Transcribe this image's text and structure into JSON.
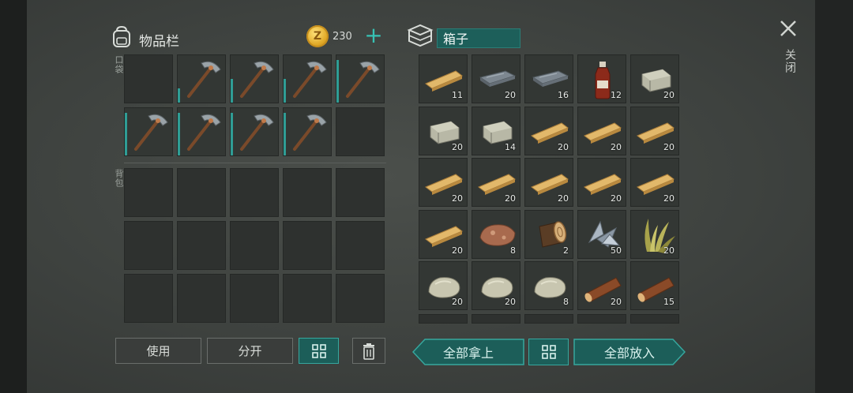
{
  "inventory": {
    "title": "物品栏",
    "coin_symbol": "Z",
    "coins": "230",
    "add_label": "+",
    "pocket_label": "口袋",
    "backpack_label": "背包",
    "pocket_slots": [
      {
        "item": "empty"
      },
      {
        "item": "pickaxe",
        "durability": 0.3
      },
      {
        "item": "pickaxe",
        "durability": 0.5
      },
      {
        "item": "pickaxe",
        "durability": 0.5
      },
      {
        "item": "pickaxe",
        "durability": 0.9
      },
      {
        "item": "pickaxe",
        "durability": 0.9
      },
      {
        "item": "pickaxe",
        "durability": 0.9
      },
      {
        "item": "pickaxe",
        "durability": 0.9
      },
      {
        "item": "pickaxe",
        "durability": 0.9
      },
      {
        "item": "empty"
      }
    ],
    "backpack_rows": 3,
    "buttons": {
      "use": "使用",
      "split": "分开"
    }
  },
  "box": {
    "title": "箱子",
    "slots": [
      {
        "item": "plank",
        "count": "11"
      },
      {
        "item": "iron-bar",
        "count": "20"
      },
      {
        "item": "iron-bar",
        "count": "16"
      },
      {
        "item": "bottle",
        "count": "12"
      },
      {
        "item": "stone-block",
        "count": "20"
      },
      {
        "item": "stone-block",
        "count": "20"
      },
      {
        "item": "stone-block",
        "count": "14"
      },
      {
        "item": "plank",
        "count": "20"
      },
      {
        "item": "plank",
        "count": "20"
      },
      {
        "item": "plank",
        "count": "20"
      },
      {
        "item": "plank",
        "count": "20"
      },
      {
        "item": "plank",
        "count": "20"
      },
      {
        "item": "plank",
        "count": "20"
      },
      {
        "item": "plank",
        "count": "20"
      },
      {
        "item": "plank",
        "count": "20"
      },
      {
        "item": "plank",
        "count": "20"
      },
      {
        "item": "ore",
        "count": "8"
      },
      {
        "item": "log",
        "count": "2"
      },
      {
        "item": "scrap-metal",
        "count": "50"
      },
      {
        "item": "grass",
        "count": "20"
      },
      {
        "item": "rock",
        "count": "20"
      },
      {
        "item": "rock",
        "count": "20"
      },
      {
        "item": "rock",
        "count": "8"
      },
      {
        "item": "stick",
        "count": "20"
      },
      {
        "item": "stick",
        "count": "15"
      }
    ],
    "buttons": {
      "take_all": "全部拿上",
      "put_all": "全部放入"
    }
  },
  "close": {
    "label": "关闭"
  },
  "colors": {
    "accent": "#37c2b4",
    "button_teal": "#1c5e59",
    "slot": "#2e312f"
  }
}
